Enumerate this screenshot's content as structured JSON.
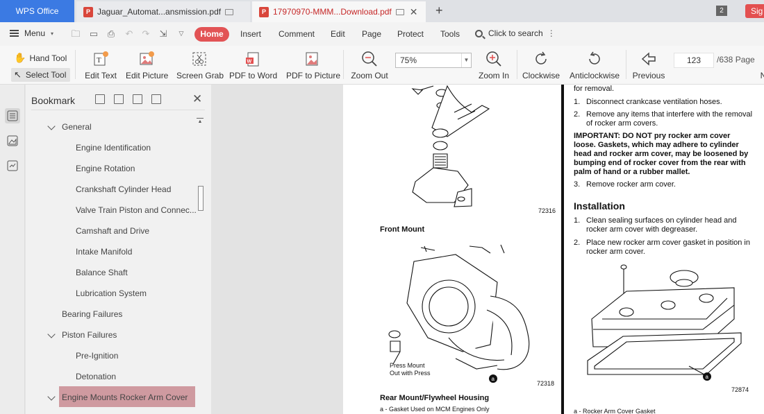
{
  "tabs": {
    "app": "WPS Office",
    "doc1": "Jaguar_Automat...ansmission.pdf",
    "doc2": "17970970-MMM...Download.pdf",
    "count_badge": "2",
    "signin": "Sig"
  },
  "menu": {
    "menu_label": "Menu",
    "items": [
      "Home",
      "Insert",
      "Comment",
      "Edit",
      "Page",
      "Protect",
      "Tools"
    ],
    "search": "Click to search"
  },
  "toolbar": {
    "hand_tool": "Hand Tool",
    "select_tool": "Select Tool",
    "edit_text": "Edit Text",
    "edit_picture": "Edit Picture",
    "screen_grab": "Screen Grab",
    "pdf_to_word": "PDF to Word",
    "pdf_to_picture": "PDF to Picture",
    "zoom_out": "Zoom Out",
    "zoom_value": "75%",
    "zoom_in": "Zoom In",
    "clockwise": "Clockwise",
    "anticlockwise": "Anticlockwise",
    "previous": "Previous",
    "page_current": "123",
    "page_total": "/638 Page",
    "next_cut": "N"
  },
  "bookmark": {
    "title": "Bookmark",
    "items": [
      "General",
      "Engine Identification",
      "Engine Rotation",
      "Crankshaft Cylinder Head",
      "Valve Train Piston and Connec...",
      "Camshaft and Drive",
      "Intake Manifold",
      "Balance Shaft",
      "Lubrication System",
      "Bearing Failures",
      "Piston Failures",
      "Pre-Ignition",
      "Detonation",
      "Engine Mounts Rocker Arm Cover"
    ]
  },
  "document": {
    "fig1_code": "72316",
    "front_mount": "Front Mount",
    "press_mount_1": "Press Mount",
    "press_mount_2": "Out with Press",
    "fig2_code": "72318",
    "rear_mount": "Rear Mount/Flywheel Housing",
    "rear_note": "a - Gasket Used on MCM Engines Only",
    "for_removal": "for removal.",
    "step_disconnect": "Disconnect crankcase ventilation hoses.",
    "step_remove_items_1": "Remove any items that interfere with the removal",
    "step_remove_items_2": "of rocker arm covers.",
    "important_1": "IMPORTANT: DO NOT pry rocker arm cover",
    "important_2": "loose. Gaskets, which may adhere to cylinder",
    "important_3": "head and rocker arm cover, may be loosened by",
    "important_4": "bumping end of rocker cover from the rear with",
    "important_5": "palm of hand or a rubber mallet.",
    "step_remove_cover": "Remove rocker arm cover.",
    "installation": "Installation",
    "install_1a": "Clean sealing surfaces on cylinder head and",
    "install_1b": "rocker arm cover with degreaser.",
    "install_2a": "Place new rocker arm cover gasket in position in",
    "install_2b": "rocker arm cover.",
    "fig3_code": "72874",
    "fig3_caption": "a - Rocker Arm Cover Gasket",
    "callout_a": "a",
    "n1": "1.",
    "n2": "2.",
    "n3": "3."
  }
}
